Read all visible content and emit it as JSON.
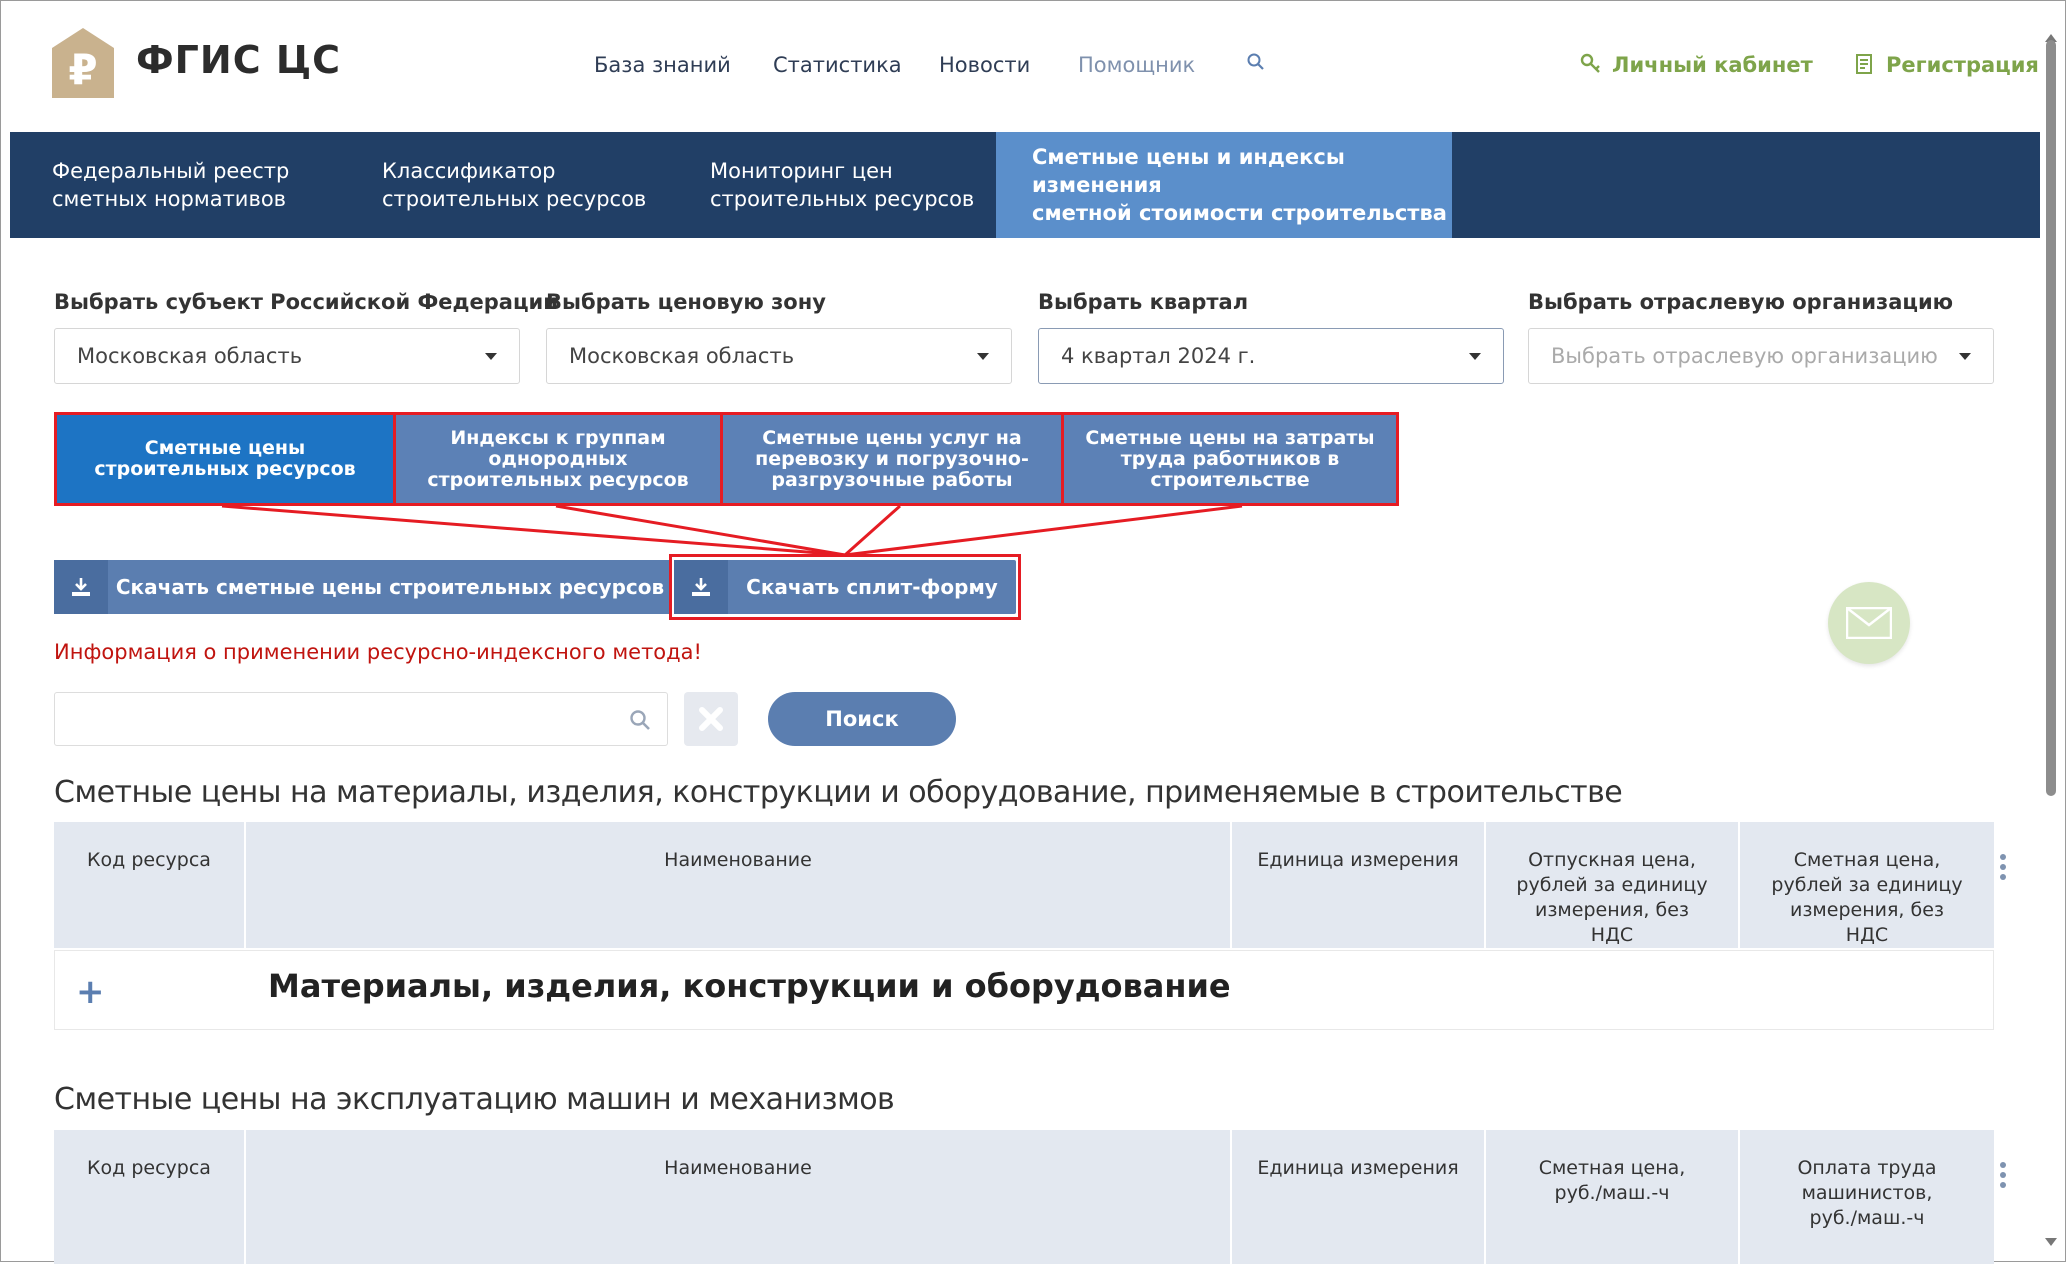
{
  "header": {
    "logo_text": "ФГИС ЦС",
    "nav": [
      "База знаний",
      "Статистика",
      "Новости",
      "Помощник"
    ],
    "account_link": "Личный кабинет",
    "register_link": "Регистрация"
  },
  "main_nav": [
    {
      "line1": "Федеральный реестр",
      "line2": "сметных нормативов"
    },
    {
      "line1": "Классификатор",
      "line2": "строительных ресурсов"
    },
    {
      "line1": "Мониторинг цен",
      "line2": "строительных ресурсов"
    },
    {
      "line1": "Сметные цены и индексы изменения",
      "line2": "сметной стоимости строительства"
    }
  ],
  "filters": [
    {
      "label": "Выбрать субъект Российской Федерации",
      "value": "Московская область"
    },
    {
      "label": "Выбрать ценовую зону",
      "value": "Московская область"
    },
    {
      "label": "Выбрать квартал",
      "value": "4 квартал 2024 г."
    },
    {
      "label": "Выбрать отраслевую организацию",
      "placeholder": "Выбрать отраслевую организацию"
    }
  ],
  "tabs": [
    "Сметные цены строительных ресурсов",
    "Индексы к группам однородных строительных ресурсов",
    "Сметные цены услуг на перевозку и погрузочно-разгрузочные работы",
    "Сметные цены на затраты труда работников в строительстве"
  ],
  "download_resources_label": "Скачать сметные цены строительных ресурсов",
  "download_split_label": "Скачать сплит-форму",
  "info_link": "Информация о применении ресурсно-индексного метода!",
  "search_button": "Поиск",
  "section1": {
    "title": "Сметные цены на материалы, изделия, конструкции и оборудование, применяемые в строительстве",
    "headers": [
      "Код ресурса",
      "Наименование",
      "Единица измерения",
      "Отпускная цена, рублей за единицу измерения, без НДС",
      "Сметная цена, рублей за единицу измерения, без НДС"
    ],
    "group_row": "Материалы, изделия, конструкции и оборудование"
  },
  "section2": {
    "title": "Сметные цены на эксплуатацию машин и механизмов",
    "headers": [
      "Код ресурса",
      "Наименование",
      "Единица измерения",
      "Сметная цена, руб./маш.-ч",
      "Оплата труда машинистов, руб./маш.-ч"
    ]
  },
  "colors": {
    "nav_dark": "#213f66",
    "nav_active": "#5b8fcb",
    "button_blue": "#5b7eb0",
    "tab_active": "#1d74c4",
    "highlight_red": "#e51c23",
    "green": "#7ea44a"
  }
}
